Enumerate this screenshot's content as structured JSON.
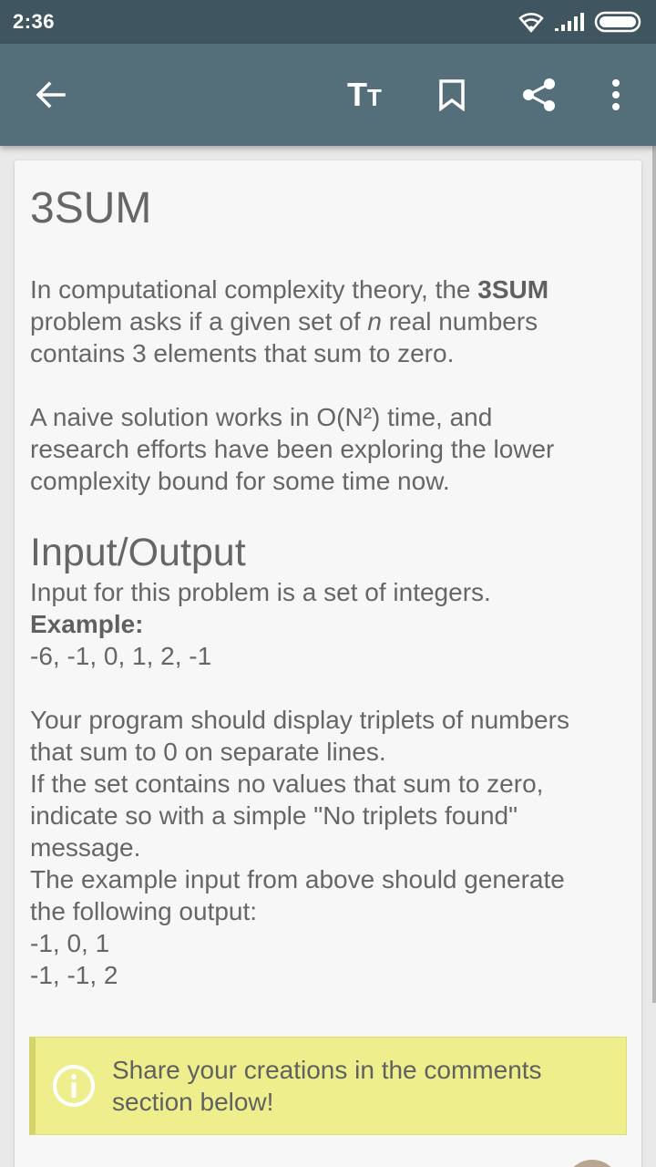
{
  "status_bar": {
    "time": "2:36",
    "icons": [
      "wifi-icon",
      "signal-icon",
      "battery-icon"
    ]
  },
  "app_bar": {
    "buttons": [
      "back-arrow-icon",
      "text-size-icon",
      "bookmark-icon",
      "share-icon",
      "more-vert-icon"
    ],
    "text_size_glyph_big": "T",
    "text_size_glyph_small": "T"
  },
  "article": {
    "title": "3SUM",
    "intro": {
      "line1_pre": "In computational complexity theory, the ",
      "line1_bold": "3SUM",
      "line2_pre": "problem asks if a given set of ",
      "line2_italic": "n",
      "line2_post": " real numbers",
      "line3": "contains 3 elements that sum to zero."
    },
    "para2": [
      "A naive solution works in O(N²) time, and",
      "research efforts have been exploring the lower",
      "complexity bound for some time now."
    ],
    "section_heading": "Input/Output",
    "io": {
      "line1": "Input for this problem is a set of integers.",
      "example_label": "Example:",
      "example_value": "-6, -1, 0, 1, 2, -1"
    },
    "para4": [
      "Your program should display triplets of numbers",
      "that sum to 0 on separate lines.",
      "If the set contains no values that sum to zero,",
      "indicate so with a simple \"No triplets found\"",
      "message.",
      "The example input from above should generate",
      "the following output:",
      "-1, 0, 1",
      "-1, -1, 2"
    ],
    "callout": {
      "icon": "info-icon",
      "line1": "Share your creations in the comments",
      "line2": "section below!"
    }
  },
  "colors": {
    "status_bar": "#3f5560",
    "app_bar": "#546e7a",
    "card": "#f7f7f7",
    "callout_bg": "#eeee8c",
    "callout_border": "#d4d46a",
    "text": "#666666"
  }
}
